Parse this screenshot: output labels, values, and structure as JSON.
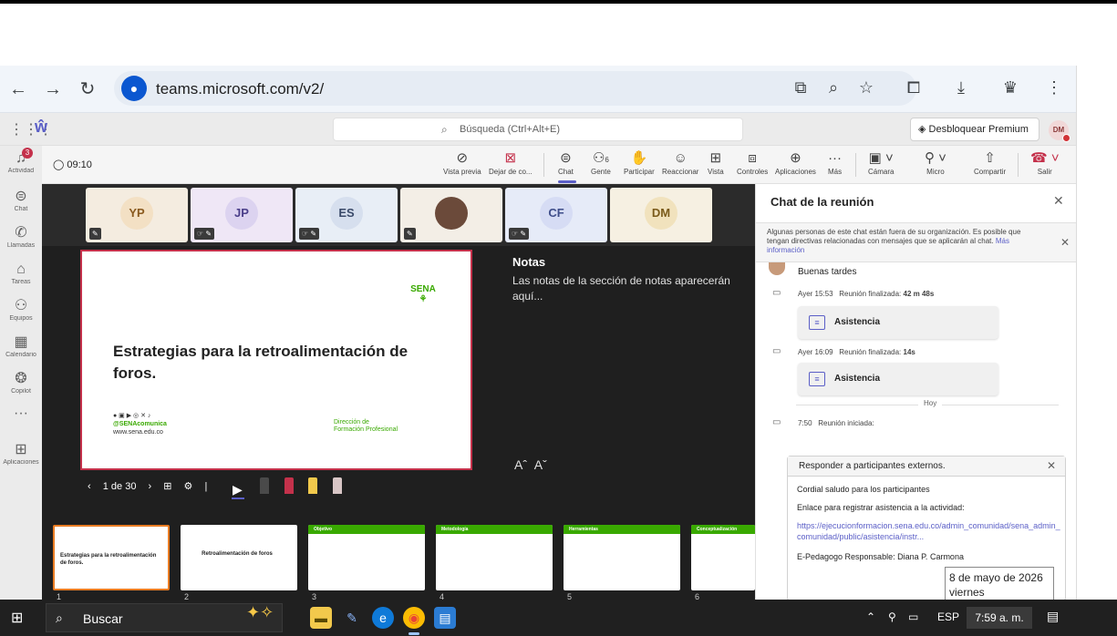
{
  "browser": {
    "url": "teams.microsoft.com/v2/"
  },
  "teams": {
    "search_placeholder": "Búsqueda (Ctrl+Alt+E)",
    "premium_label": "Desbloquear Premium",
    "premium_more": "···",
    "user_initials": "DM"
  },
  "rail": {
    "items": [
      {
        "label": "Actividad",
        "icon": "bell-icon",
        "badge": "3"
      },
      {
        "label": "Chat",
        "icon": "chat-icon"
      },
      {
        "label": "Llamadas",
        "icon": "phone-icon"
      },
      {
        "label": "Tareas",
        "icon": "tasks-icon"
      },
      {
        "label": "Equipos",
        "icon": "teams-icon"
      },
      {
        "label": "Calendario",
        "icon": "calendar-icon"
      },
      {
        "label": "Copilot",
        "icon": "copilot-icon"
      },
      {
        "label": "···",
        "icon": "more-icon"
      },
      {
        "label": "Aplicaciones",
        "icon": "apps-add-icon"
      }
    ]
  },
  "meeting": {
    "timer": "09:10",
    "toolbar": [
      {
        "label": "Vista previa",
        "icon": "eye-off-icon"
      },
      {
        "label": "Dejar de co...",
        "icon": "stop-share-icon"
      },
      {
        "label": "Chat",
        "icon": "chat-icon"
      },
      {
        "label": "Gente",
        "icon": "people-icon",
        "count": "6"
      },
      {
        "label": "Participar",
        "icon": "hand-icon"
      },
      {
        "label": "Reaccionar",
        "icon": "smile-icon"
      },
      {
        "label": "Vista",
        "icon": "grid-icon"
      },
      {
        "label": "Controles",
        "icon": "controls-icon"
      },
      {
        "label": "Aplicaciones",
        "icon": "add-app-icon"
      },
      {
        "label": "Más",
        "icon": "more-icon"
      },
      {
        "label": "Cámara",
        "icon": "camera-off-icon"
      },
      {
        "label": "Micro",
        "icon": "mic-icon"
      },
      {
        "label": "Compartir",
        "icon": "share-icon"
      },
      {
        "label": "Salir",
        "icon": "hangup-icon"
      }
    ],
    "participants": [
      {
        "initials": "YP",
        "bg": "#f3e7d8",
        "fg": "#8a5a1f"
      },
      {
        "initials": "JP",
        "bg": "#e8e3f3",
        "fg": "#4b3f8a"
      },
      {
        "initials": "ES",
        "bg": "#e3e8f3",
        "fg": "#3a4a6a"
      },
      {
        "initials": "",
        "bg": "#f0e6e0",
        "fg": "#333"
      },
      {
        "initials": "CF",
        "bg": "#e3e8f7",
        "fg": "#3f4e8a"
      },
      {
        "initials": "DM",
        "bg": "#f5ead4",
        "fg": "#7a5a1a"
      }
    ],
    "slide": {
      "title": "Estrategias para la retroalimentación de foros.",
      "logo_text": "SENA",
      "social": "@SENAcomunica",
      "website": "www.sena.edu.co",
      "dept_line1": "Dirección de",
      "dept_line2": "Formación Profesional"
    },
    "notes": {
      "title": "Notas",
      "body": "Las notas de la sección de notas aparecerán aquí..."
    },
    "slide_counter": "1 de 30",
    "thumbnails": [
      {
        "num": "1",
        "title": "Estrategias para la retroalimentación de foros."
      },
      {
        "num": "2",
        "title": "Retroalimentación de foros"
      },
      {
        "num": "3",
        "title": "Objetivo"
      },
      {
        "num": "4",
        "title": "Metodología"
      },
      {
        "num": "5",
        "title": "Herramientas"
      },
      {
        "num": "6",
        "title": "Conceptualización"
      }
    ]
  },
  "chat": {
    "title": "Chat de la reunión",
    "banner_text": "Algunas personas de este chat están fuera de su organización. Es posible que tengan directivas relacionadas con mensajes que se aplicarán al chat.",
    "banner_link": "Más información",
    "greeting": "Buenas tardes",
    "event1_time": "Ayer 15:53",
    "event1_text": "Reunión finalizada:",
    "event1_duration": "42 m 48s",
    "attendance_label": "Asistencia",
    "event2_time": "Ayer 16:09",
    "event2_text": "Reunión finalizada:",
    "event2_duration": "14s",
    "today_label": "Hoy",
    "event3_time": "7:50",
    "event3_text": "Reunión iniciada:",
    "ext_reply": "Responder a participantes externos.",
    "ext_line1": "Cordial saludo para los participantes",
    "ext_line2": "Enlace para registrar asistencia a la actividad:",
    "ext_link": "https://ejecucionformacion.sena.edu.co/admin_comunidad/sena_admin_comunidad/public/asistencia/instr...",
    "ext_line3": "E-Pedagogo Responsable: Diana P. Carmona"
  },
  "tooltip": {
    "date": "8 de mayo de 2026",
    "weekday": "viernes"
  },
  "taskbar": {
    "search_label": "Buscar",
    "lang": "ESP",
    "time": "7:59 a. m."
  }
}
